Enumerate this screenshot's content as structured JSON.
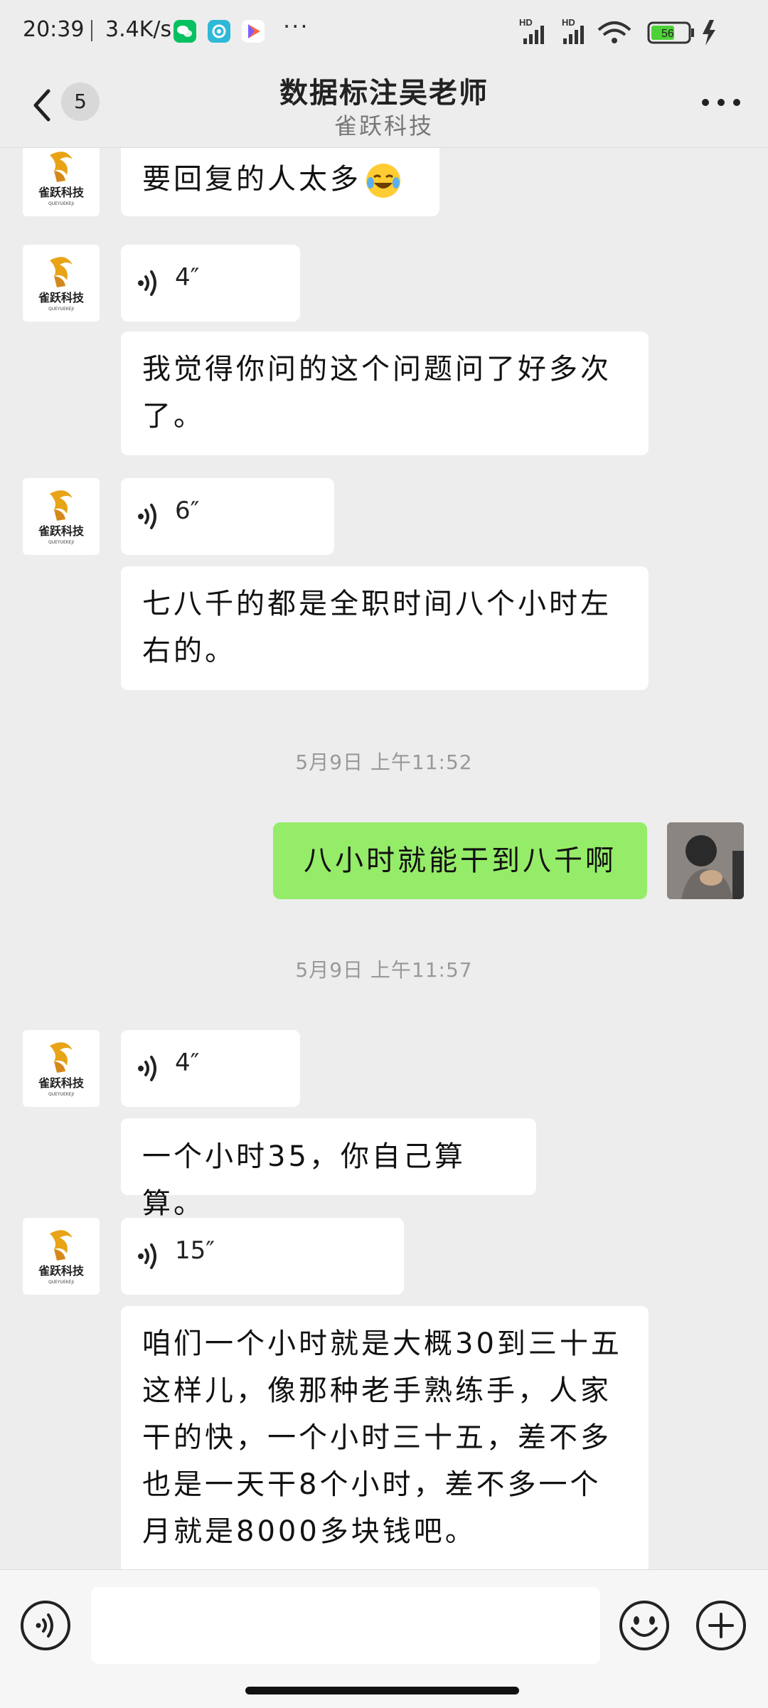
{
  "status_bar": {
    "time": "20:39",
    "net_speed": "3.4K/s",
    "more": "···",
    "battery": "56"
  },
  "header": {
    "unread_count": "5",
    "title": "数据标注吴老师",
    "subtitle": "雀跃科技"
  },
  "avatar_logo_text": "雀跃科技",
  "messages": {
    "m1": {
      "text": "要回复的人太多"
    },
    "v1": {
      "length": "4″"
    },
    "m2": {
      "text": "我觉得你问的这个问题问了好多次了。"
    },
    "v2": {
      "length": "6″"
    },
    "m3": {
      "text": "七八千的都是全职时间八个小时左右的。"
    },
    "t1": {
      "text": "5月9日 上午11:52"
    },
    "me1": {
      "text": "八小时就能干到八千啊"
    },
    "t2": {
      "text": "5月9日 上午11:57"
    },
    "v3": {
      "length": "4″"
    },
    "m4": {
      "text": "一个小时35，你自己算算。"
    },
    "v4": {
      "length": "15″"
    },
    "m5": {
      "text": "咱们一个小时就是大概30到三十五这样儿，像那种老手熟练手，人家干的快，一个小时三十五，差不多也是一天干8个小时，差不多一个月就是8000多块钱吧。"
    }
  },
  "colors": {
    "background": "#ededed",
    "bubble_other": "#ffffff",
    "bubble_self": "#95ec69",
    "timestamp": "#999999"
  },
  "icons": {
    "back": "chevron-left-icon",
    "more": "more-horizontal-icon",
    "voice": "voice-wave-icon",
    "emoji": "smile-icon",
    "plus": "plus-circle-icon"
  }
}
